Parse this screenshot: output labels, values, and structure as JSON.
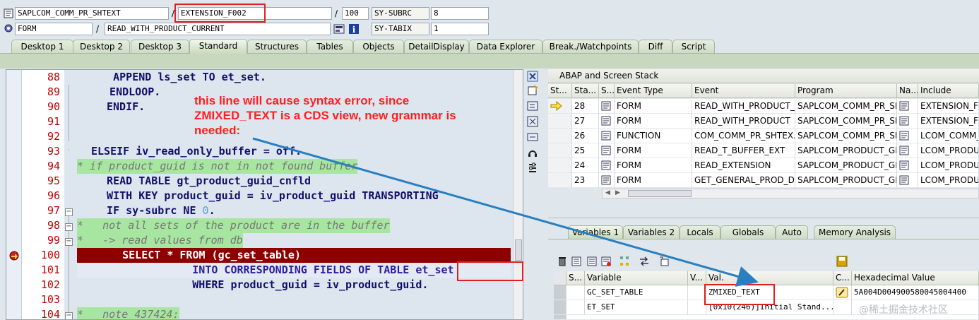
{
  "topbar": {
    "row1": {
      "program": "SAPLCOM_COMM_PR_SHTEXT",
      "slash1": "/",
      "include": "EXTENSION_F002",
      "slash2": "/",
      "line": "100",
      "sysfield": "SY-SUBRC",
      "sysval": "8"
    },
    "row2": {
      "type": "FORM",
      "slash1": "/",
      "event": "READ_WITH_PRODUCT_CURRENT",
      "sysfield": "SY-TABIX",
      "sysval": "1"
    }
  },
  "tabs": [
    "Desktop 1",
    "Desktop 2",
    "Desktop 3",
    "Standard",
    "Structures",
    "Tables",
    "Objects",
    "DetailDisplay",
    "Data Explorer",
    "Break./Watchpoints",
    "Diff",
    "Script"
  ],
  "active_tab": "Standard",
  "code": {
    "line_numbers": [
      "88",
      "89",
      "90",
      "91",
      "92",
      "93",
      "94",
      "95",
      "96",
      "97",
      "98",
      "99",
      "100",
      "101",
      "102",
      "103",
      "104"
    ],
    "l88": "    APPEND ls_set TO et_set.",
    "l89": "  ENDLOOP.",
    "l90": "ENDIF.",
    "l93": "ELSEIF iv_read_only_buffer = off.",
    "l94": "* if product_guid is not in not found buffer",
    "l95": "  READ TABLE gt_product_guid_cnfld",
    "l96": "  WITH KEY product_guid = iv_product_guid TRANSPORTING",
    "l97a": "  IF sy-subrc NE ",
    "l97b": "0",
    "l97c": ".",
    "l98": "*   not all sets of the product are in the buffer",
    "l99": "*   -> read values from db",
    "l100": "    SELECT * FROM (gc_set_table)",
    "l101": "         INTO CORRESPONDING FIELDS OF TABLE et_set",
    "l102": "         WHERE product_guid = iv_product_guid.",
    "l104": "*   note 437424:"
  },
  "annotation": {
    "line1": "this line will cause syntax error, since",
    "line2": "ZMIXED_TEXT is a CDS view, new grammar is",
    "line3": "needed:"
  },
  "stack": {
    "title": "ABAP and Screen Stack",
    "headers": [
      "St...",
      "Sta...",
      "S...",
      "Event Type",
      "Event",
      "Program",
      "Na...",
      "Include"
    ],
    "rows": [
      {
        "step": "28",
        "type": "FORM",
        "event": "READ_WITH_PRODUCT_...",
        "program": "SAPLCOM_COMM_PR_SH...",
        "include": "EXTENSION_F0"
      },
      {
        "step": "27",
        "type": "FORM",
        "event": "READ_WITH_PRODUCT",
        "program": "SAPLCOM_COMM_PR_SH...",
        "include": "EXTENSION_F0"
      },
      {
        "step": "26",
        "type": "FUNCTION",
        "event": "COM_COMM_PR_SHTEX...",
        "program": "SAPLCOM_COMM_PR_SH...",
        "include": "LCOM_COMM_P"
      },
      {
        "step": "25",
        "type": "FORM",
        "event": "READ_T_BUFFER_EXT",
        "program": "SAPLCOM_PRODUCT_GE...",
        "include": "LCOM_PRODUC"
      },
      {
        "step": "24",
        "type": "FORM",
        "event": "READ_EXTENSION",
        "program": "SAPLCOM_PRODUCT_GE...",
        "include": "LCOM_PRODUC"
      },
      {
        "step": "23",
        "type": "FORM",
        "event": "GET_GENERAL_PROD_D...",
        "program": "SAPLCOM_PRODUCT_GE...",
        "include": "LCOM_PRODUC"
      }
    ]
  },
  "var_tabs": [
    "Variables 1",
    "Variables 2",
    "Locals",
    "Globals",
    "Auto",
    "Memory Analysis"
  ],
  "vars": {
    "headers": [
      "S...",
      "Variable",
      "V...",
      "Val.",
      "C...",
      "Hexadecimal Value"
    ],
    "rows": [
      {
        "name": "GC_SET_TABLE",
        "value": "ZMIXED_TEXT",
        "hex": "5A004D004900580045004400"
      },
      {
        "name": "ET_SET",
        "value": "[0x10(246)]Initial Stand...",
        "hex": ""
      }
    ]
  },
  "watermark": "@稀土掘金技术社区",
  "colors": {
    "highlight": "#8e0000",
    "comment_bg": "#a7e6a1",
    "annotation": "#ff1f1f",
    "arrow": "#2a7fc1",
    "box": "#e02020"
  }
}
